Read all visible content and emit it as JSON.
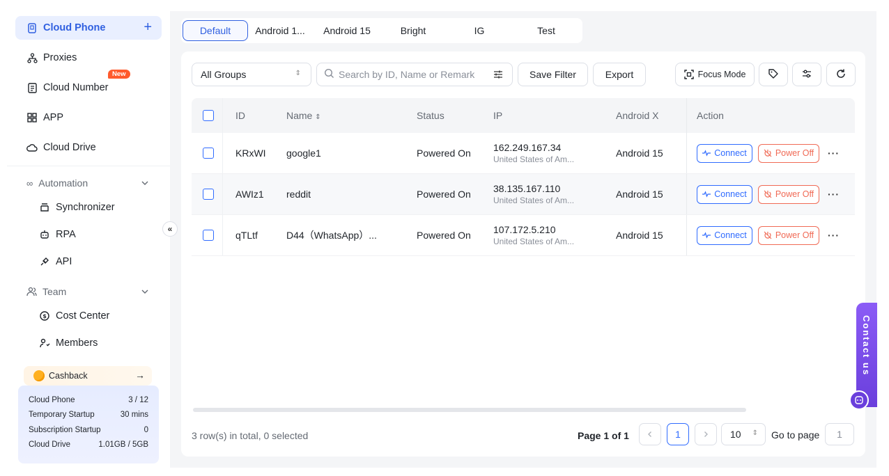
{
  "sidebar": {
    "items": [
      {
        "label": "Cloud Phone",
        "icon": "phone-icon",
        "active": true
      },
      {
        "label": "Proxies",
        "icon": "proxies-icon"
      },
      {
        "label": "Cloud Number",
        "icon": "document-icon",
        "badge": "New"
      },
      {
        "label": "APP",
        "icon": "grid-icon"
      },
      {
        "label": "Cloud Drive",
        "icon": "cloud-icon"
      }
    ],
    "automation": {
      "label": "Automation",
      "items": [
        {
          "label": "Synchronizer"
        },
        {
          "label": "RPA"
        },
        {
          "label": "API"
        }
      ]
    },
    "team": {
      "label": "Team",
      "items": [
        {
          "label": "Cost Center"
        },
        {
          "label": "Members"
        }
      ]
    },
    "cashback": {
      "label": "Cashback",
      "arrow": "→"
    },
    "usage": [
      {
        "label": "Cloud Phone",
        "value": "3 / 12"
      },
      {
        "label": "Temporary Startup",
        "value": "30 mins"
      },
      {
        "label": "Subscription Startup",
        "value": "0"
      },
      {
        "label": "Cloud Drive",
        "value": "1.01GB / 5GB"
      }
    ]
  },
  "tabs": [
    "Default",
    "Android 1...",
    "Android 15",
    "Bright",
    "IG",
    "Test"
  ],
  "toolbar": {
    "group": "All Groups",
    "search_placeholder": "Search by ID, Name or Remark",
    "save_filter": "Save Filter",
    "export": "Export",
    "focus_mode": "Focus Mode"
  },
  "table": {
    "headers": [
      "ID",
      "Name",
      "Status",
      "IP",
      "Android X",
      "Action"
    ],
    "rows": [
      {
        "id": "KRxWI",
        "name": "google1",
        "status": "Powered On",
        "ip": "162.249.167.34",
        "location": "United States of Am...",
        "android": "Android 15"
      },
      {
        "id": "AWIz1",
        "name": "reddit",
        "status": "Powered On",
        "ip": "38.135.167.110",
        "location": "United States of Am...",
        "android": "Android 15"
      },
      {
        "id": "qTLtf",
        "name": "D44（WhatsApp）...",
        "status": "Powered On",
        "ip": "107.172.5.210",
        "location": "United States of Am...",
        "android": "Android 15"
      }
    ],
    "connect_label": "Connect",
    "power_off_label": "Power Off"
  },
  "footer": {
    "count": "3 row(s) in total, 0 selected",
    "page_info": "Page 1 of 1",
    "current_page": "1",
    "page_size": "10",
    "goto_label": "Go to page",
    "goto_value": "1"
  },
  "contact": "Contact us",
  "colors": {
    "accent": "#2f5fe0",
    "danger": "#f06a55",
    "contact": "#6a3fdc"
  }
}
